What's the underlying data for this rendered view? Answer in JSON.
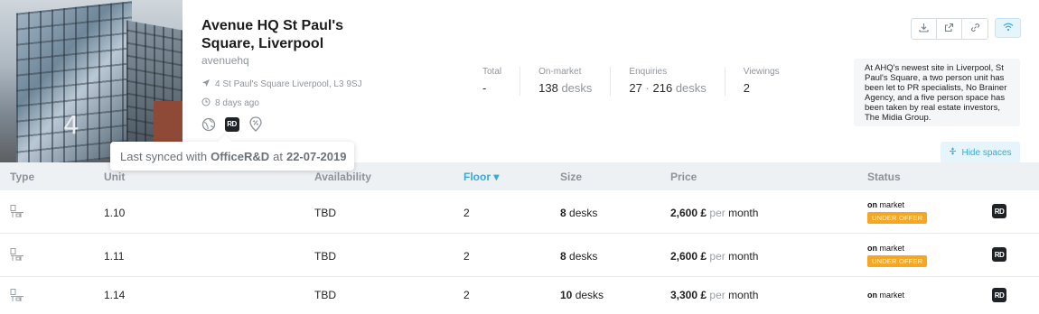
{
  "property": {
    "title": "Avenue HQ St Paul's Square, Liverpool",
    "handle": "avenuehq",
    "address": "4 St Paul's Square Liverpool, L3 9SJ",
    "updated": "8 days ago",
    "channel_badge": "RD",
    "description": "At AHQ's newest site in Liverpool, St Paul's Square, a two person unit has been let to PR specialists, No Brainer Agency, and a five person space has been taken by real estate investors, The Midia Group.",
    "photo_text": "4"
  },
  "stats": {
    "total": {
      "label": "Total",
      "value": "-"
    },
    "on_market": {
      "label": "On-market",
      "value": "138",
      "unit": "desks"
    },
    "enquiries": {
      "label": "Enquiries",
      "value": "27",
      "sep": "·",
      "value2": "216",
      "unit": "desks"
    },
    "viewings": {
      "label": "Viewings",
      "value": "2"
    }
  },
  "tooltip": {
    "prefix": "Last synced with",
    "source": "OfficeR&D",
    "at": "at",
    "date": "22-07-2019"
  },
  "hide_spaces": "Hide spaces",
  "table": {
    "headers": {
      "type": "Type",
      "unit": "Unit",
      "availability": "Availability",
      "floor": "Floor",
      "floor_sort": "▾",
      "size": "Size",
      "price": "Price",
      "status": "Status"
    },
    "rows": [
      {
        "unit": "1.10",
        "availability": "TBD",
        "floor": "2",
        "size_value": "8",
        "size_unit": "desks",
        "price": "2,600 £",
        "per": "per",
        "period": "month",
        "status_on": "on",
        "status_market": "market",
        "badge": "UNDER OFFER",
        "rd": "RD"
      },
      {
        "unit": "1.11",
        "availability": "TBD",
        "floor": "2",
        "size_value": "8",
        "size_unit": "desks",
        "price": "2,600 £",
        "per": "per",
        "period": "month",
        "status_on": "on",
        "status_market": "market",
        "badge": "UNDER OFFER",
        "rd": "RD"
      },
      {
        "unit": "1.14",
        "availability": "TBD",
        "floor": "2",
        "size_value": "10",
        "size_unit": "desks",
        "price": "3,300 £",
        "per": "per",
        "period": "month",
        "status_on": "on",
        "status_market": "market",
        "badge": "",
        "rd": "RD"
      }
    ]
  },
  "colors": {
    "accent": "#3aa9d8",
    "badge": "#f5a623",
    "header_bg": "#eef1f4"
  }
}
